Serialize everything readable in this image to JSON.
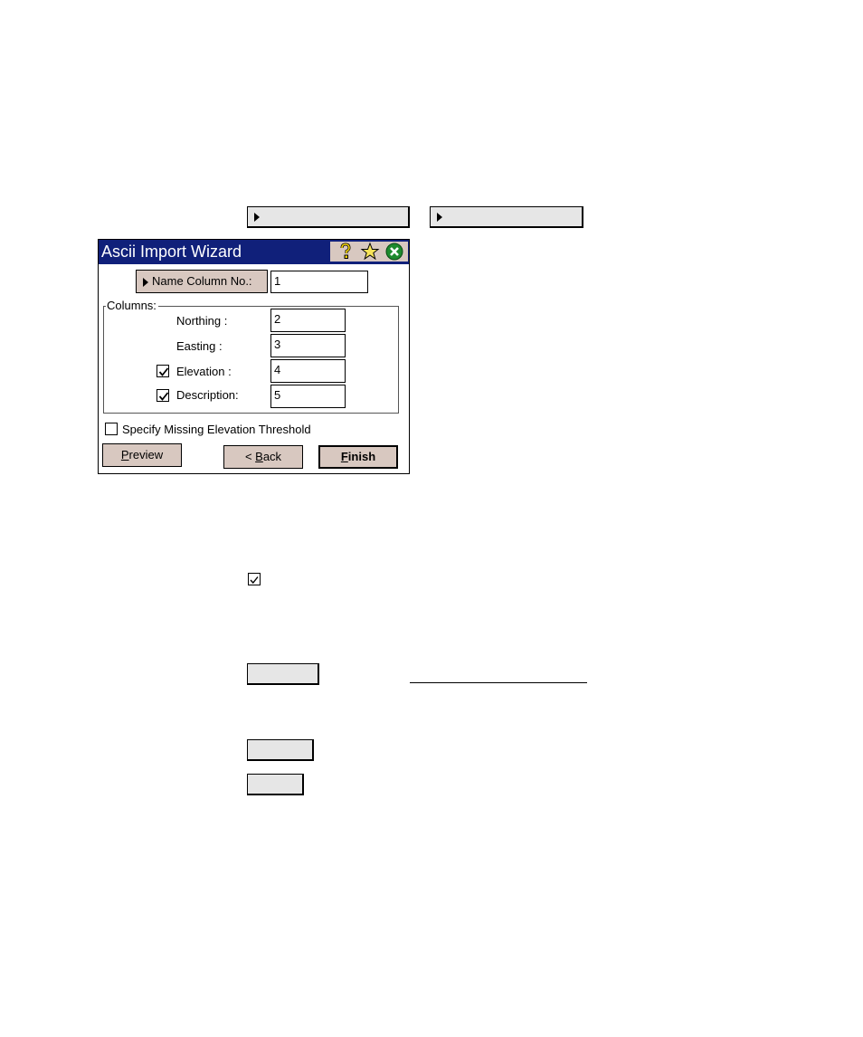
{
  "window": {
    "title": "Ascii Import Wizard",
    "titlebar_icons": [
      "help-icon",
      "star-icon",
      "close-icon"
    ],
    "name_column": {
      "label": "Name Column No.:",
      "value": "1"
    },
    "columns_group": {
      "legend": "Columns:",
      "rows": [
        {
          "label": "Northing :",
          "value": "2",
          "has_checkbox": false
        },
        {
          "label": "Easting :",
          "value": "3",
          "has_checkbox": false
        },
        {
          "label": "Elevation :",
          "value": "4",
          "has_checkbox": true,
          "checked": true
        },
        {
          "label": "Description:",
          "value": "5",
          "has_checkbox": true,
          "checked": true
        }
      ]
    },
    "missing_elevation": {
      "label": "Specify Missing Elevation Threshold",
      "checked": false
    },
    "buttons": {
      "preview": {
        "mnemonic": "P",
        "rest": "review"
      },
      "back": {
        "prefix": "< ",
        "mnemonic": "B",
        "rest": "ack"
      },
      "finish": {
        "mnemonic": "F",
        "rest": "inish"
      }
    }
  },
  "colors": {
    "titlebar": "#10207a",
    "button_face": "#d8c8c0",
    "doc_button_face": "#e6e6e6"
  }
}
